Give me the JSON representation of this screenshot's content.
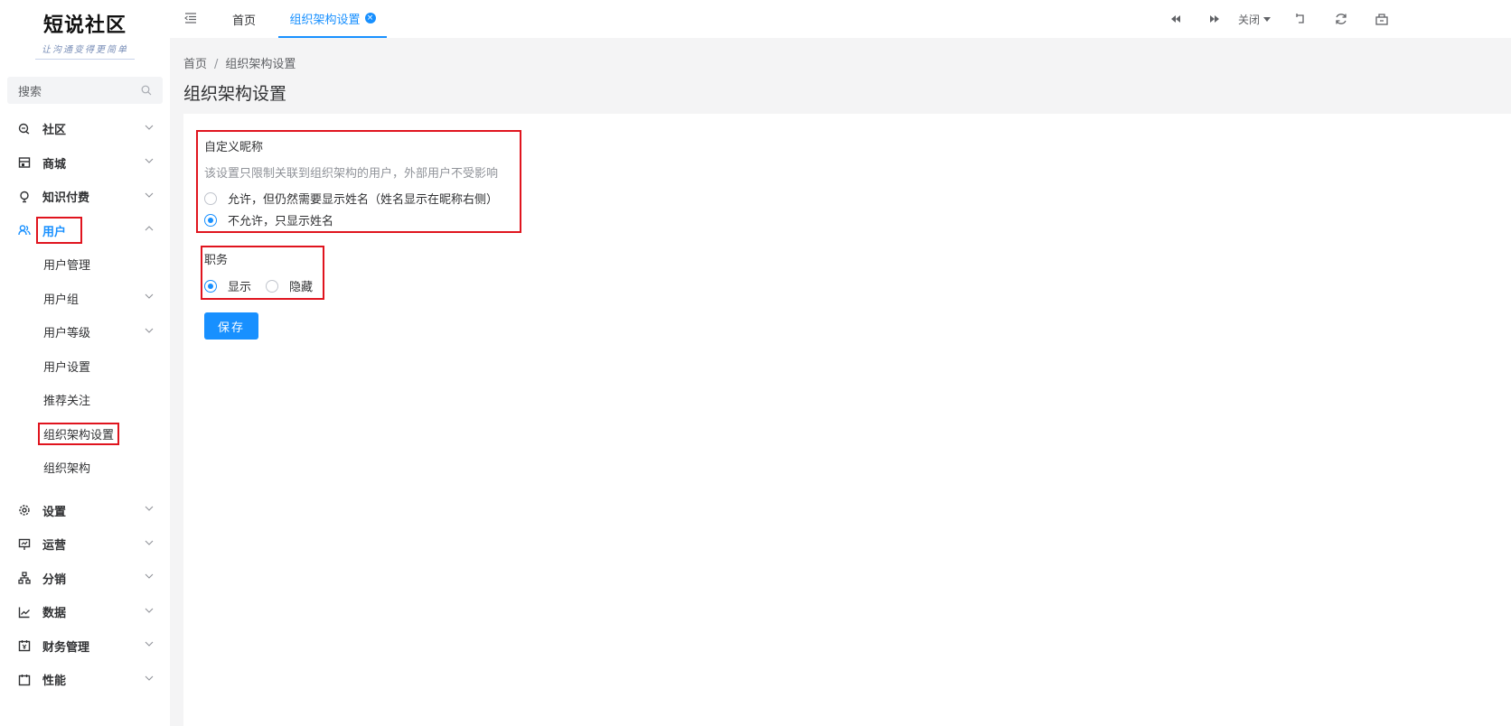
{
  "logo": {
    "title": "短说社区",
    "slogan": "让沟通变得更简单"
  },
  "search": {
    "placeholder": "搜索"
  },
  "menu": {
    "community": "社区",
    "mall": "商城",
    "knowledge": "知识付费",
    "user": "用户",
    "user_sub": [
      "用户管理",
      "用户组",
      "用户等级",
      "用户设置",
      "推荐关注",
      "组织架构设置",
      "组织架构"
    ],
    "settings": "设置",
    "operation": "运营",
    "distribution": "分销",
    "data": "数据",
    "finance": "财务管理",
    "performance": "性能"
  },
  "topbar": {
    "tab_home": "首页",
    "tab_active": "组织架构设置",
    "close_label": "关闭"
  },
  "breadcrumb": {
    "home": "首页",
    "sep": "/",
    "current": "组织架构设置"
  },
  "page_title": "组织架构设置",
  "form": {
    "nickname_title": "自定义昵称",
    "nickname_hint": "该设置只限制关联到组织架构的用户，外部用户不受影响",
    "nickname_opt1": "允许，但仍然需要显示姓名（姓名显示在昵称右侧）",
    "nickname_opt2": "不允许，只显示姓名",
    "nickname_selected": "不允许，只显示姓名",
    "job_title": "职务",
    "job_opt_show": "显示",
    "job_opt_hide": "隐藏",
    "job_selected": "显示",
    "save_label": "保存"
  },
  "colors": {
    "accent": "#1890ff",
    "highlight": "#e0141e"
  }
}
